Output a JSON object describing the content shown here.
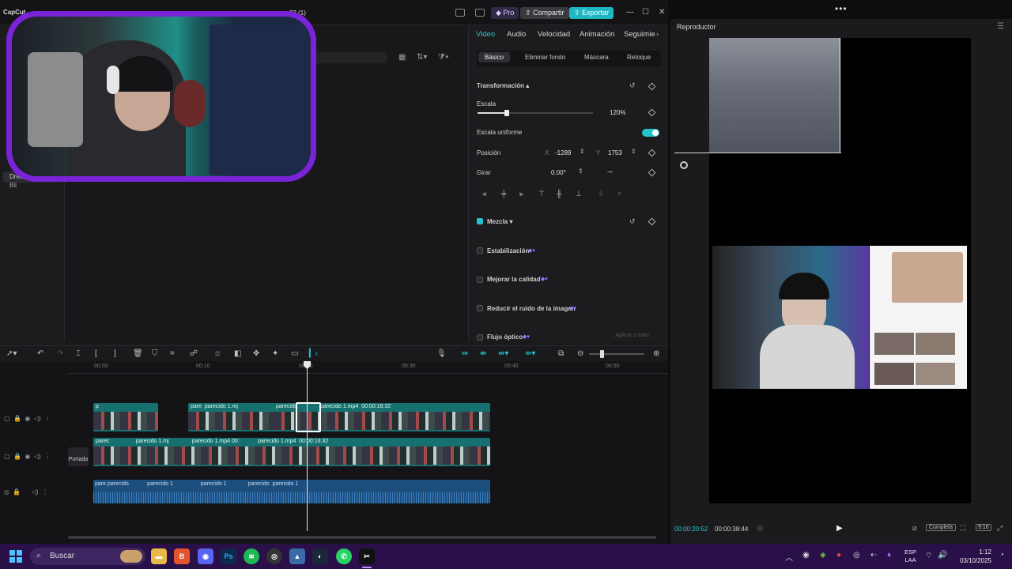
{
  "titlebar": {
    "app_name": "CapCut",
    "project_name": "03 (1)",
    "pro_label": "Pro",
    "share_label": "Compartir",
    "export_label": "Exportar"
  },
  "media_panel": {
    "sidebar_items": [
      "Bil",
      "Dreamina"
    ]
  },
  "inspector": {
    "tabs": [
      "Video",
      "Audio",
      "Velocidad",
      "Animación",
      "Seguimie"
    ],
    "subtabs": [
      "Básico",
      "Eliminar fondo",
      "Máscara",
      "Retoque"
    ],
    "transform_label": "Transformación",
    "scale_label": "Escala",
    "scale_value": "120%",
    "scale_level": 0.25,
    "uniform_scale_label": "Escala uniforme",
    "position_label": "Posición",
    "pos_x_label": "X",
    "pos_x_value": "-1289",
    "pos_y_label": "Y",
    "pos_y_value": "1753",
    "rotate_label": "Girar",
    "rotate_value": "0.00°",
    "blend_label": "Mezcla",
    "stabilize_label": "Estabilización",
    "quality_label": "Mejorar la calidad",
    "noise_label": "Reducir el ruido de la imagen",
    "optical_flow_label": "Flujo óptico",
    "apply_all_label": "Aplicar a todo"
  },
  "timeline": {
    "ticks": [
      "00:00",
      "00:10",
      "00:20",
      "00:30",
      "00:40",
      "00:50"
    ],
    "cover_label": "Portada",
    "clip_name": "parecido 1.mp4",
    "clip_duration": "00:00:16:32",
    "clip_short": "parecido 1",
    "clip_partial": "parecido",
    "clip_tiny": "parec",
    "clip_p": "p",
    "clip_parc": "parc",
    "clip_pare": "pare",
    "clip_pa": "pa",
    "clip_mp4": "parecido 1.mp4",
    "clip_mp4_short": "parecido 1.mj",
    "clip_00": "00:"
  },
  "player": {
    "title": "Reproductor",
    "time_current": "00:00:20:52",
    "time_total": "00:00:38:44",
    "complete_label": "Completa",
    "ratio_label": "9:16"
  },
  "taskbar": {
    "search_label": "Buscar",
    "lang_top": "ESP",
    "lang_bottom": "LAA",
    "time": "1:12",
    "date": "03/10/2025"
  },
  "colors": {
    "accent": "#22c3cd",
    "webcam_border": "#7a23d8",
    "taskbar": "#2a1048"
  }
}
